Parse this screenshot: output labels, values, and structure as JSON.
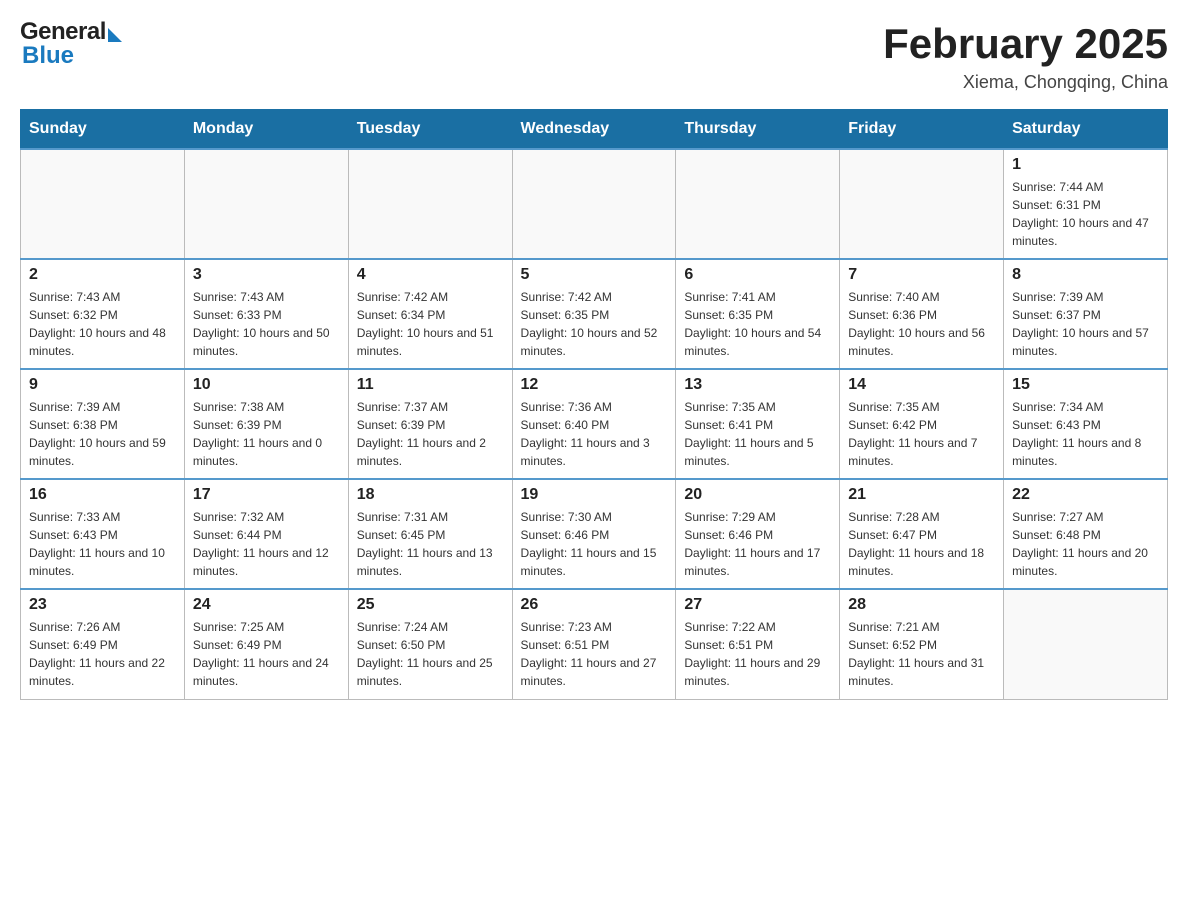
{
  "header": {
    "logo_general": "General",
    "logo_arrow": "▶",
    "logo_blue": "Blue",
    "month_title": "February 2025",
    "location": "Xiema, Chongqing, China"
  },
  "days_of_week": [
    "Sunday",
    "Monday",
    "Tuesday",
    "Wednesday",
    "Thursday",
    "Friday",
    "Saturday"
  ],
  "weeks": [
    [
      {
        "day": "",
        "sunrise": "",
        "sunset": "",
        "daylight": ""
      },
      {
        "day": "",
        "sunrise": "",
        "sunset": "",
        "daylight": ""
      },
      {
        "day": "",
        "sunrise": "",
        "sunset": "",
        "daylight": ""
      },
      {
        "day": "",
        "sunrise": "",
        "sunset": "",
        "daylight": ""
      },
      {
        "day": "",
        "sunrise": "",
        "sunset": "",
        "daylight": ""
      },
      {
        "day": "",
        "sunrise": "",
        "sunset": "",
        "daylight": ""
      },
      {
        "day": "1",
        "sunrise": "Sunrise: 7:44 AM",
        "sunset": "Sunset: 6:31 PM",
        "daylight": "Daylight: 10 hours and 47 minutes."
      }
    ],
    [
      {
        "day": "2",
        "sunrise": "Sunrise: 7:43 AM",
        "sunset": "Sunset: 6:32 PM",
        "daylight": "Daylight: 10 hours and 48 minutes."
      },
      {
        "day": "3",
        "sunrise": "Sunrise: 7:43 AM",
        "sunset": "Sunset: 6:33 PM",
        "daylight": "Daylight: 10 hours and 50 minutes."
      },
      {
        "day": "4",
        "sunrise": "Sunrise: 7:42 AM",
        "sunset": "Sunset: 6:34 PM",
        "daylight": "Daylight: 10 hours and 51 minutes."
      },
      {
        "day": "5",
        "sunrise": "Sunrise: 7:42 AM",
        "sunset": "Sunset: 6:35 PM",
        "daylight": "Daylight: 10 hours and 52 minutes."
      },
      {
        "day": "6",
        "sunrise": "Sunrise: 7:41 AM",
        "sunset": "Sunset: 6:35 PM",
        "daylight": "Daylight: 10 hours and 54 minutes."
      },
      {
        "day": "7",
        "sunrise": "Sunrise: 7:40 AM",
        "sunset": "Sunset: 6:36 PM",
        "daylight": "Daylight: 10 hours and 56 minutes."
      },
      {
        "day": "8",
        "sunrise": "Sunrise: 7:39 AM",
        "sunset": "Sunset: 6:37 PM",
        "daylight": "Daylight: 10 hours and 57 minutes."
      }
    ],
    [
      {
        "day": "9",
        "sunrise": "Sunrise: 7:39 AM",
        "sunset": "Sunset: 6:38 PM",
        "daylight": "Daylight: 10 hours and 59 minutes."
      },
      {
        "day": "10",
        "sunrise": "Sunrise: 7:38 AM",
        "sunset": "Sunset: 6:39 PM",
        "daylight": "Daylight: 11 hours and 0 minutes."
      },
      {
        "day": "11",
        "sunrise": "Sunrise: 7:37 AM",
        "sunset": "Sunset: 6:39 PM",
        "daylight": "Daylight: 11 hours and 2 minutes."
      },
      {
        "day": "12",
        "sunrise": "Sunrise: 7:36 AM",
        "sunset": "Sunset: 6:40 PM",
        "daylight": "Daylight: 11 hours and 3 minutes."
      },
      {
        "day": "13",
        "sunrise": "Sunrise: 7:35 AM",
        "sunset": "Sunset: 6:41 PM",
        "daylight": "Daylight: 11 hours and 5 minutes."
      },
      {
        "day": "14",
        "sunrise": "Sunrise: 7:35 AM",
        "sunset": "Sunset: 6:42 PM",
        "daylight": "Daylight: 11 hours and 7 minutes."
      },
      {
        "day": "15",
        "sunrise": "Sunrise: 7:34 AM",
        "sunset": "Sunset: 6:43 PM",
        "daylight": "Daylight: 11 hours and 8 minutes."
      }
    ],
    [
      {
        "day": "16",
        "sunrise": "Sunrise: 7:33 AM",
        "sunset": "Sunset: 6:43 PM",
        "daylight": "Daylight: 11 hours and 10 minutes."
      },
      {
        "day": "17",
        "sunrise": "Sunrise: 7:32 AM",
        "sunset": "Sunset: 6:44 PM",
        "daylight": "Daylight: 11 hours and 12 minutes."
      },
      {
        "day": "18",
        "sunrise": "Sunrise: 7:31 AM",
        "sunset": "Sunset: 6:45 PM",
        "daylight": "Daylight: 11 hours and 13 minutes."
      },
      {
        "day": "19",
        "sunrise": "Sunrise: 7:30 AM",
        "sunset": "Sunset: 6:46 PM",
        "daylight": "Daylight: 11 hours and 15 minutes."
      },
      {
        "day": "20",
        "sunrise": "Sunrise: 7:29 AM",
        "sunset": "Sunset: 6:46 PM",
        "daylight": "Daylight: 11 hours and 17 minutes."
      },
      {
        "day": "21",
        "sunrise": "Sunrise: 7:28 AM",
        "sunset": "Sunset: 6:47 PM",
        "daylight": "Daylight: 11 hours and 18 minutes."
      },
      {
        "day": "22",
        "sunrise": "Sunrise: 7:27 AM",
        "sunset": "Sunset: 6:48 PM",
        "daylight": "Daylight: 11 hours and 20 minutes."
      }
    ],
    [
      {
        "day": "23",
        "sunrise": "Sunrise: 7:26 AM",
        "sunset": "Sunset: 6:49 PM",
        "daylight": "Daylight: 11 hours and 22 minutes."
      },
      {
        "day": "24",
        "sunrise": "Sunrise: 7:25 AM",
        "sunset": "Sunset: 6:49 PM",
        "daylight": "Daylight: 11 hours and 24 minutes."
      },
      {
        "day": "25",
        "sunrise": "Sunrise: 7:24 AM",
        "sunset": "Sunset: 6:50 PM",
        "daylight": "Daylight: 11 hours and 25 minutes."
      },
      {
        "day": "26",
        "sunrise": "Sunrise: 7:23 AM",
        "sunset": "Sunset: 6:51 PM",
        "daylight": "Daylight: 11 hours and 27 minutes."
      },
      {
        "day": "27",
        "sunrise": "Sunrise: 7:22 AM",
        "sunset": "Sunset: 6:51 PM",
        "daylight": "Daylight: 11 hours and 29 minutes."
      },
      {
        "day": "28",
        "sunrise": "Sunrise: 7:21 AM",
        "sunset": "Sunset: 6:52 PM",
        "daylight": "Daylight: 11 hours and 31 minutes."
      },
      {
        "day": "",
        "sunrise": "",
        "sunset": "",
        "daylight": ""
      }
    ]
  ]
}
